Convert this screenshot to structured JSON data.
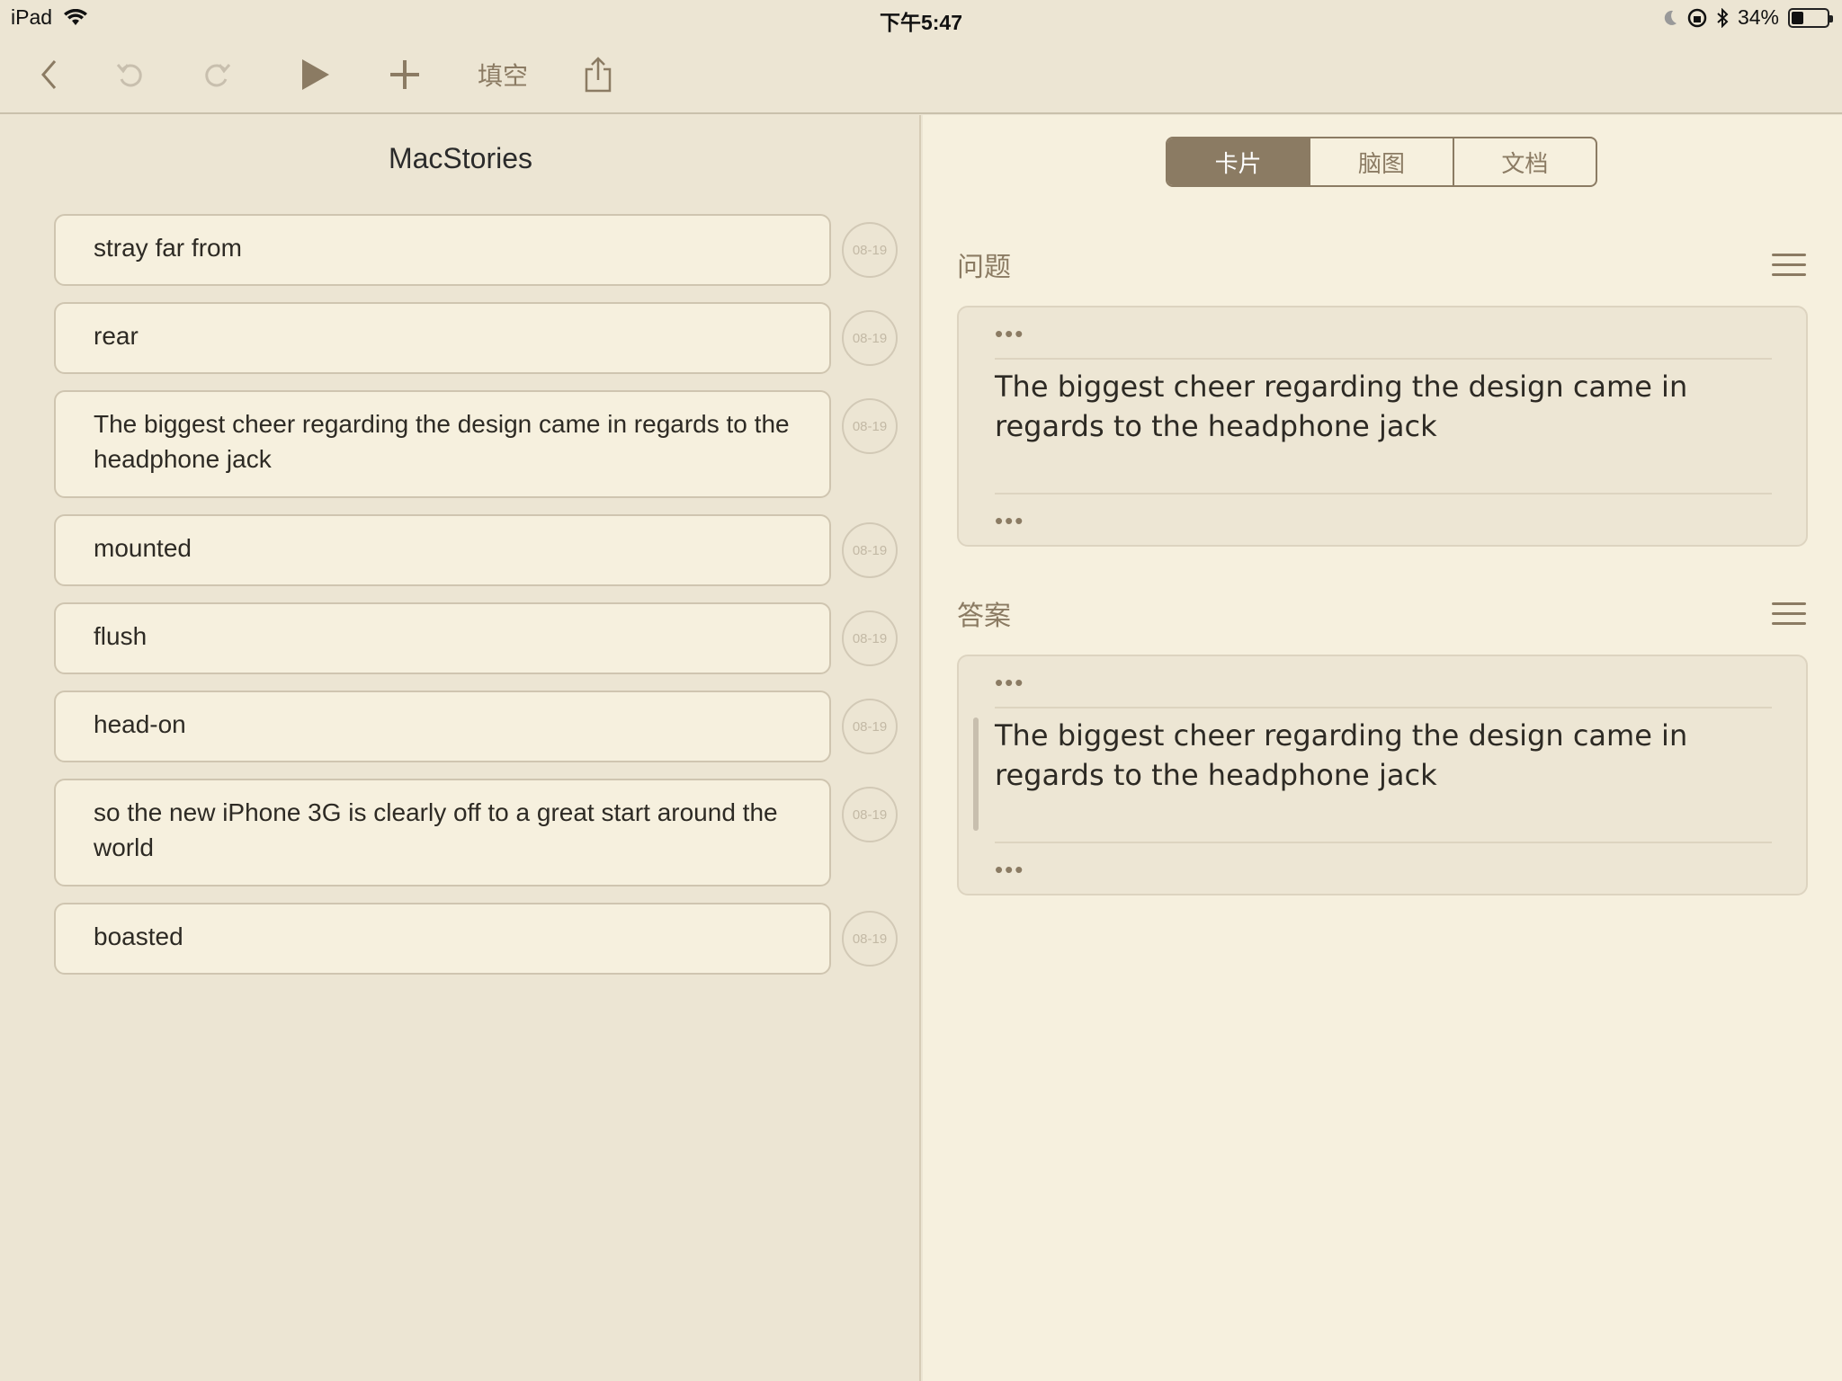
{
  "status": {
    "device": "iPad",
    "time": "下午5:47",
    "battery": "34%",
    "battery_level": 0.34
  },
  "toolbar": {
    "back_icon": "chevron-left-icon",
    "undo_icon": "undo-icon",
    "redo_icon": "redo-icon",
    "play_icon": "play-icon",
    "add_icon": "plus-icon",
    "cloze_label": "填空",
    "share_icon": "share-icon"
  },
  "left": {
    "title": "MacStories",
    "items": [
      {
        "text": "stray far from",
        "date": "08-19"
      },
      {
        "text": "rear",
        "date": "08-19"
      },
      {
        "text": "The biggest cheer regarding the design came in regards to the headphone jack",
        "date": "08-19"
      },
      {
        "text": "mounted",
        "date": "08-19"
      },
      {
        "text": "flush",
        "date": "08-19"
      },
      {
        "text": "head-on",
        "date": "08-19"
      },
      {
        "text": "so the new iPhone 3G is clearly off to a great start around the world",
        "date": "08-19"
      },
      {
        "text": "boasted",
        "date": "08-19"
      }
    ]
  },
  "right": {
    "tabs": [
      "卡片",
      "脑图",
      "文档"
    ],
    "active_tab": "卡片",
    "question_label": "问题",
    "answer_label": "答案",
    "question_text": "The biggest cheer regarding the design came in regards to the headphone jack",
    "answer_text": "The biggest cheer regarding the design came in regards to the headphone jack",
    "dots": "•••"
  },
  "colors": {
    "accent": "#8b7b63",
    "background": "#ece5d3",
    "card": "#f6f0de"
  }
}
